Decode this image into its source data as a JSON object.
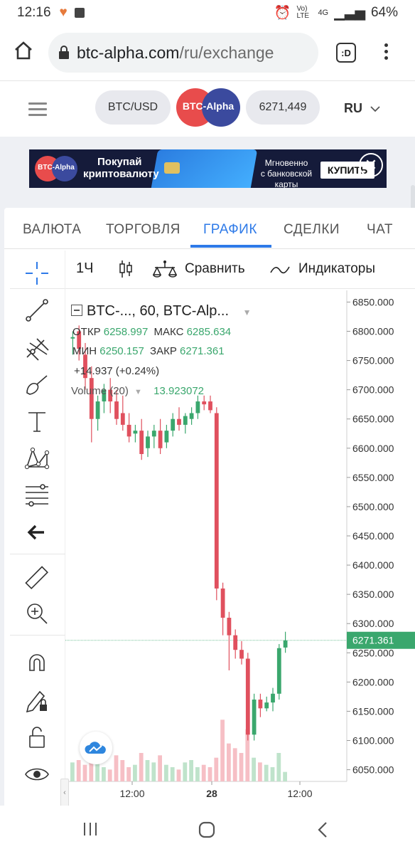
{
  "status_bar": {
    "time": "12:16",
    "network": "Vo) LTE",
    "network_type": "4G",
    "battery": "64%"
  },
  "browser": {
    "url_host": "btc-alpha.com",
    "url_path": "/ru/exchange",
    "tab_count": ":D"
  },
  "site_header": {
    "pair": "BTC/USD",
    "logo": "BTC-Alpha",
    "price": "6271,449",
    "lang": "RU"
  },
  "banner": {
    "brand": "BTC-Alpha",
    "headline_1": "Покупай",
    "headline_2": "криптовалюту",
    "subtitle_1": "Мгновенно",
    "subtitle_2": "с банковской карты",
    "button": "КУПИТЬ"
  },
  "tabs": [
    {
      "label": "ВАЛЮТА",
      "active": false
    },
    {
      "label": "ТОРГОВЛЯ",
      "active": false
    },
    {
      "label": "ГРАФИК",
      "active": true
    },
    {
      "label": "СДЕЛКИ",
      "active": false
    },
    {
      "label": "ЧАТ",
      "active": false
    }
  ],
  "chart_toolbar": {
    "interval": "1Ч",
    "compare": "Сравнить",
    "indicators": "Индикаторы"
  },
  "legend": {
    "symbol": "BTC-..., 60, BTC-Alp...",
    "open_label": "ОТКР",
    "open": "6258.997",
    "high_label": "МАКС",
    "high": "6285.634",
    "low_label": "МИН",
    "low": "6250.157",
    "close_label": "ЗАКР",
    "close": "6271.361",
    "change": "+14.937 (+0.24%)",
    "volume_label": "Volume (20)",
    "volume": "13.923072"
  },
  "colors": {
    "up": "#3aa76d",
    "down": "#e0505e",
    "up_volume": "#bfe3cb",
    "down_volume": "#f6bfc5",
    "accent": "#2e7ae8",
    "last_price_bg": "#3aa76d"
  },
  "chart_data": {
    "type": "candlestick",
    "ylim": [
      6030,
      6870
    ],
    "y_ticks": [
      "6850.000",
      "6800.000",
      "6750.000",
      "6700.000",
      "6650.000",
      "6600.000",
      "6550.000",
      "6500.000",
      "6450.000",
      "6400.000",
      "6350.000",
      "6300.000",
      "6250.000",
      "6200.000",
      "6150.000",
      "6100.000",
      "6050.000"
    ],
    "x_ticks": [
      "12:00",
      "28",
      "12:00"
    ],
    "last_price": "6271.361",
    "candles": [
      {
        "o": 6790,
        "h": 6800,
        "l": 6760,
        "c": 6790
      },
      {
        "o": 6800,
        "h": 6810,
        "l": 6750,
        "c": 6770
      },
      {
        "o": 6760,
        "h": 6780,
        "l": 6700,
        "c": 6720
      },
      {
        "o": 6720,
        "h": 6740,
        "l": 6610,
        "c": 6650
      },
      {
        "o": 6650,
        "h": 6690,
        "l": 6630,
        "c": 6680
      },
      {
        "o": 6680,
        "h": 6710,
        "l": 6660,
        "c": 6700
      },
      {
        "o": 6700,
        "h": 6720,
        "l": 6660,
        "c": 6680
      },
      {
        "o": 6680,
        "h": 6700,
        "l": 6640,
        "c": 6650
      },
      {
        "o": 6660,
        "h": 6690,
        "l": 6630,
        "c": 6640
      },
      {
        "o": 6640,
        "h": 6660,
        "l": 6610,
        "c": 6620
      },
      {
        "o": 6625,
        "h": 6640,
        "l": 6610,
        "c": 6630
      },
      {
        "o": 6630,
        "h": 6650,
        "l": 6580,
        "c": 6590
      },
      {
        "o": 6600,
        "h": 6630,
        "l": 6585,
        "c": 6620
      },
      {
        "o": 6620,
        "h": 6640,
        "l": 6600,
        "c": 6630
      },
      {
        "o": 6630,
        "h": 6650,
        "l": 6590,
        "c": 6600
      },
      {
        "o": 6610,
        "h": 6640,
        "l": 6600,
        "c": 6630
      },
      {
        "o": 6630,
        "h": 6660,
        "l": 6620,
        "c": 6650
      },
      {
        "o": 6650,
        "h": 6670,
        "l": 6630,
        "c": 6640
      },
      {
        "o": 6640,
        "h": 6660,
        "l": 6625,
        "c": 6655
      },
      {
        "o": 6650,
        "h": 6670,
        "l": 6640,
        "c": 6660
      },
      {
        "o": 6660,
        "h": 6690,
        "l": 6650,
        "c": 6680
      },
      {
        "o": 6680,
        "h": 6690,
        "l": 6665,
        "c": 6675
      },
      {
        "o": 6680,
        "h": 6690,
        "l": 6660,
        "c": 6665
      },
      {
        "o": 6660,
        "h": 6670,
        "l": 6340,
        "c": 6360
      },
      {
        "o": 6360,
        "h": 6370,
        "l": 6280,
        "c": 6310
      },
      {
        "o": 6310,
        "h": 6320,
        "l": 6220,
        "c": 6280
      },
      {
        "o": 6280,
        "h": 6290,
        "l": 6240,
        "c": 6255
      },
      {
        "o": 6255,
        "h": 6270,
        "l": 6230,
        "c": 6240
      },
      {
        "o": 6240,
        "h": 6250,
        "l": 6100,
        "c": 6110
      },
      {
        "o": 6110,
        "h": 6180,
        "l": 6100,
        "c": 6170
      },
      {
        "o": 6170,
        "h": 6180,
        "l": 6140,
        "c": 6155
      },
      {
        "o": 6155,
        "h": 6175,
        "l": 6150,
        "c": 6165
      },
      {
        "o": 6165,
        "h": 6190,
        "l": 6150,
        "c": 6180
      },
      {
        "o": 6180,
        "h": 6265,
        "l": 6170,
        "c": 6258
      },
      {
        "o": 6259,
        "h": 6286,
        "l": 6250,
        "c": 6271
      }
    ],
    "volumes": [
      8,
      9,
      7,
      12,
      10,
      6,
      5,
      11,
      9,
      6,
      7,
      12,
      9,
      8,
      11,
      7,
      6,
      5,
      8,
      9,
      6,
      7,
      6,
      10,
      26,
      16,
      14,
      12,
      22,
      10,
      8,
      7,
      6,
      12,
      4
    ]
  }
}
